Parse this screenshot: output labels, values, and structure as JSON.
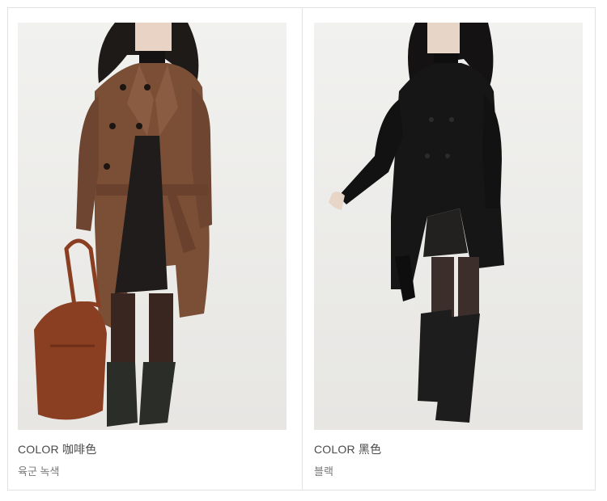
{
  "products": [
    {
      "color_label": "COLOR 咖啡色",
      "color_name_ko": "육군 녹색",
      "swatch": "#7a4f36"
    },
    {
      "color_label": "COLOR 黑色",
      "color_name_ko": "블랙",
      "swatch": "#161616"
    }
  ]
}
